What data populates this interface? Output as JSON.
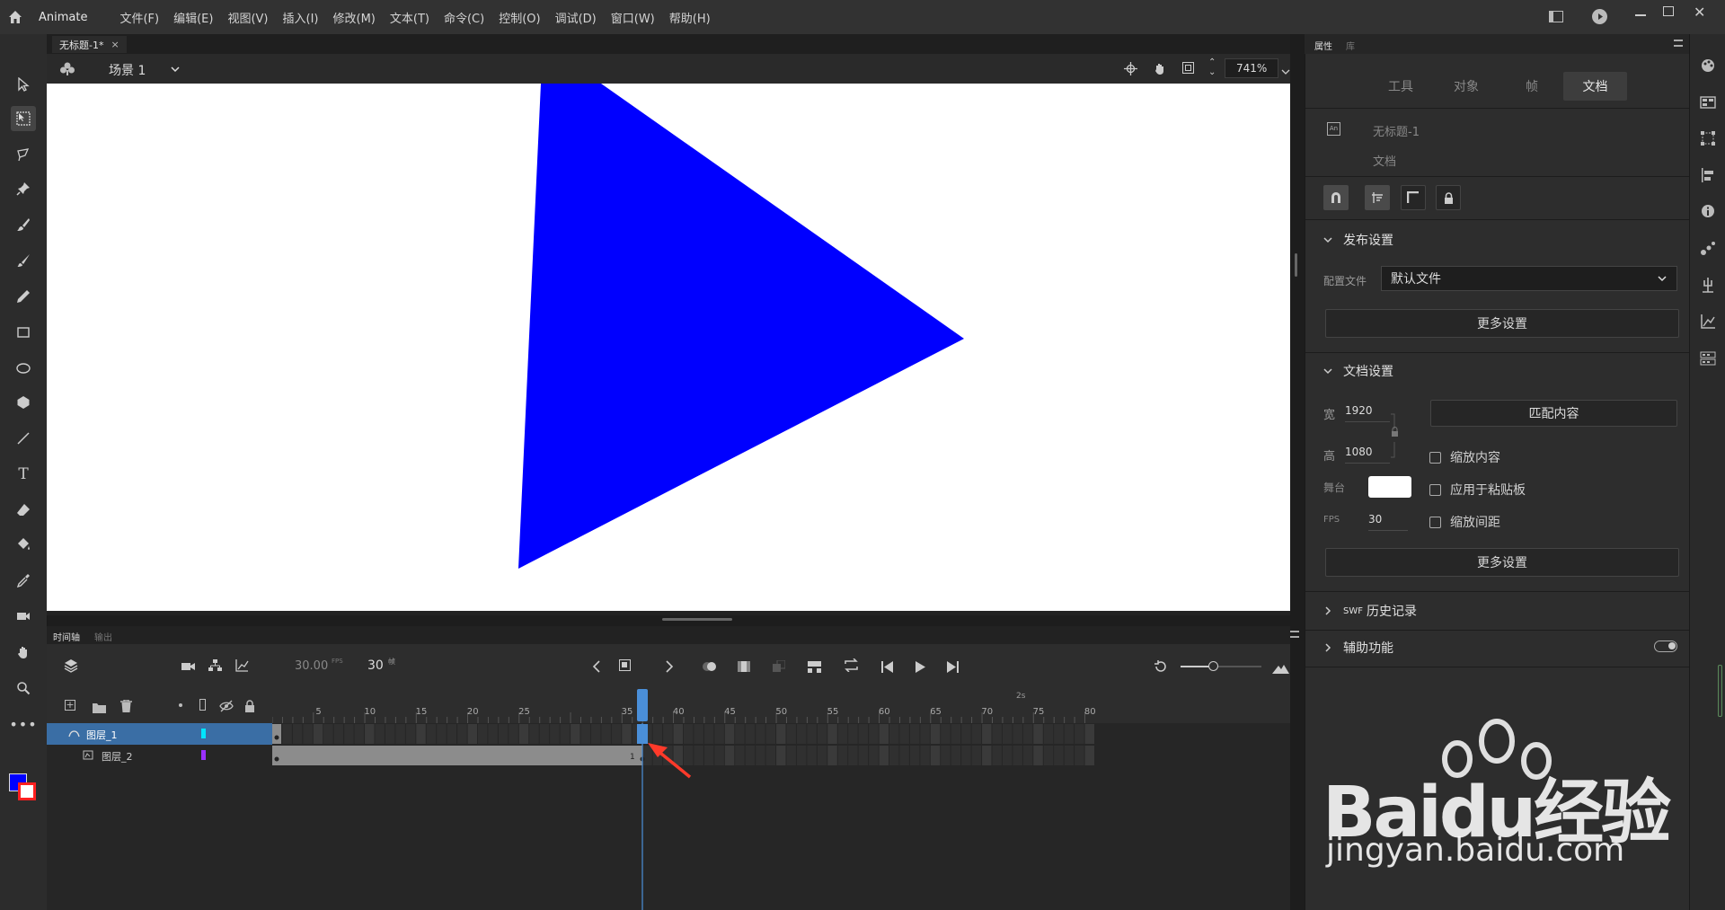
{
  "app": {
    "name": "Animate"
  },
  "menu": [
    "文件(F)",
    "编辑(E)",
    "视图(V)",
    "插入(I)",
    "修改(M)",
    "文本(T)",
    "命令(C)",
    "控制(O)",
    "调试(D)",
    "窗口(W)",
    "帮助(H)"
  ],
  "document": {
    "tab": "无标题-1*",
    "close": "×"
  },
  "scene": {
    "label": "场景 1",
    "zoom": "741%"
  },
  "stage": {
    "shape_color": "#0000ff"
  },
  "timeline": {
    "tabs": [
      "时间轴",
      "输出"
    ],
    "fps": "30.00",
    "fps_unit": "FPS",
    "frame": "30",
    "frame_unit": "帧",
    "layers": [
      {
        "name": "图层_1",
        "color": "#00e5ff",
        "selected": true
      },
      {
        "name": "图层_2",
        "color": "#9b30ff",
        "selected": false
      }
    ],
    "ruler_marks": [
      "5",
      "10",
      "15",
      "20",
      "25",
      "35",
      "40",
      "45",
      "50",
      "55",
      "60",
      "65",
      "70",
      "75",
      "80"
    ],
    "seconds_mark": "2s",
    "keyframe_marks": [
      "1",
      "0"
    ]
  },
  "properties": {
    "header_tabs": [
      "属性",
      "库"
    ],
    "tabs": [
      "工具",
      "对象",
      "帧",
      "文档"
    ],
    "active_tab": "文档",
    "doc_name": "无标题-1",
    "doc_type": "文档",
    "publish": {
      "title": "发布设置",
      "profile_label": "配置文件",
      "profile_value": "默认文件",
      "more_settings": "更多设置"
    },
    "doc_settings": {
      "title": "文档设置",
      "width_label": "宽",
      "width": "1920",
      "height_label": "高",
      "height": "1080",
      "stage_label": "舞台",
      "fps_label": "FPS",
      "fps": "30",
      "match_content": "匹配内容",
      "scale_content": "缩放内容",
      "apply_pasteboard": "应用于粘贴板",
      "scale_spacing": "缩放间距",
      "more_settings": "更多设置"
    },
    "swf_prefix": "SWF",
    "swf_history": "历史记录",
    "accessibility": "辅助功能"
  },
  "watermark": {
    "brand": "Baidu经验",
    "url": "jingyan.baidu.com"
  }
}
